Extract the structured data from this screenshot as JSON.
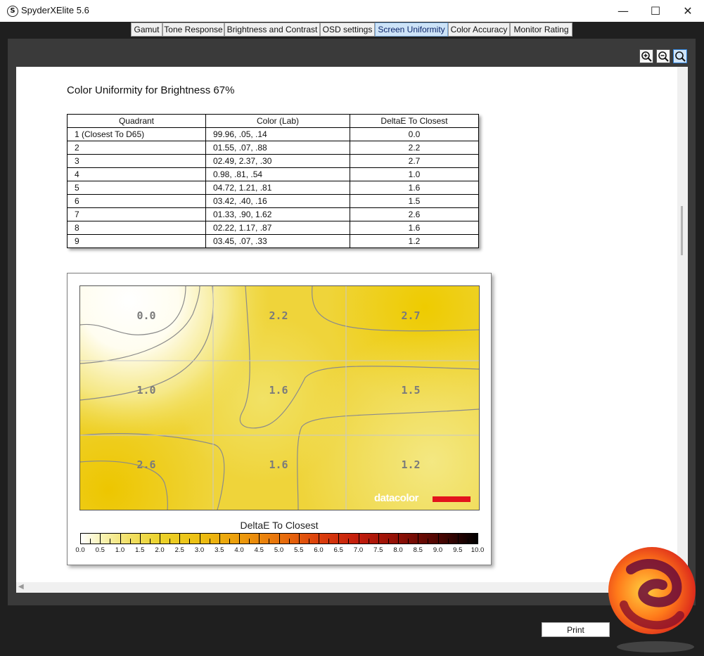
{
  "window": {
    "title": "SpyderXElite 5.6",
    "app_icon": "S",
    "minimize": "—",
    "maximize": "☐",
    "close": "✕"
  },
  "tabs": [
    {
      "label": "Gamut",
      "active": false
    },
    {
      "label": "Tone Response",
      "active": false
    },
    {
      "label": "Brightness and Contrast",
      "active": false
    },
    {
      "label": "OSD settings",
      "active": false
    },
    {
      "label": "Screen Uniformity",
      "active": true
    },
    {
      "label": "Color Accuracy",
      "active": false
    },
    {
      "label": "Monitor Rating",
      "active": false
    }
  ],
  "zoom_tools": [
    "zoom-in-icon",
    "zoom-out-icon",
    "zoom-fit-icon"
  ],
  "report": {
    "title": "Color Uniformity for Brightness 67%",
    "table": {
      "headers": [
        "Quadrant",
        "Color (Lab)",
        "DeltaE To Closest"
      ],
      "rows": [
        [
          "1 (Closest To D65)",
          "99.96,     .05,    .14",
          "0.0"
        ],
        [
          "2",
          "01.55,    .07,    .88",
          "2.2"
        ],
        [
          "3",
          "02.49,   2.37,    .30",
          "2.7"
        ],
        [
          "4",
          " 0.98,    .81,    .54",
          "1.0"
        ],
        [
          "5",
          "04.72,   1.21,    .81",
          "1.6"
        ],
        [
          "6",
          "03.42,    .40,    .16",
          "1.5"
        ],
        [
          "7",
          "01.33,    .90,   1.62",
          "2.6"
        ],
        [
          "8",
          "02.22,   1.17,    .87",
          "1.6"
        ],
        [
          "9",
          "03.45,    .07,    .33",
          "1.2"
        ]
      ]
    },
    "heatmap": {
      "grid_labels": [
        "0.0",
        "2.2",
        "2.7",
        "1.0",
        "1.6",
        "1.5",
        "2.6",
        "1.6",
        "1.2"
      ],
      "brand": "datacolor",
      "brand_color": "#e3141c"
    },
    "legend": {
      "title": "DeltaE To Closest",
      "ticks": [
        "0.0",
        "0.5",
        "1.0",
        "1.5",
        "2.0",
        "2.5",
        "3.0",
        "3.5",
        "4.0",
        "4.5",
        "5.0",
        "5.5",
        "6.0",
        "6.5",
        "7.0",
        "7.5",
        "8.0",
        "8.5",
        "9.0",
        "9.5",
        "10.0"
      ]
    }
  },
  "buttons": {
    "print": "Print"
  },
  "colors": {
    "tab_active": "#cde3f7",
    "heat_low": "#ffffff",
    "heat_mid": "#f0d630",
    "heat_high": "#000000"
  }
}
